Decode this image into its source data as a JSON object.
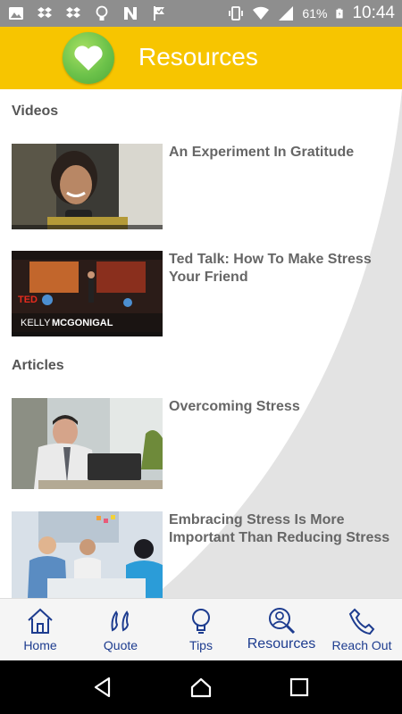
{
  "status_bar": {
    "battery_percent": "61%",
    "time": "10:44",
    "left_icons": [
      "image-icon",
      "dropbox-icon",
      "dropbox-icon",
      "lightbulb-icon",
      "n-icon",
      "check-flag-icon"
    ],
    "right_icons": [
      "vibrate-icon",
      "wifi-icon",
      "signal-icon",
      "battery-icon"
    ]
  },
  "header": {
    "title": "Resources",
    "logo_icon": "heart-icon",
    "background": "#f7c500"
  },
  "sections": {
    "videos": {
      "title": "Videos",
      "items": [
        {
          "title": "An Experiment In Gratitude",
          "thumb": "woman-on-phone"
        },
        {
          "title": "Ted Talk: How To Make Stress Your Friend",
          "thumb": "ted-talk-stage",
          "thumb_caption_a": "TED",
          "thumb_caption_b": "KELLY",
          "thumb_caption_c": "MCGONIGAL"
        }
      ]
    },
    "articles": {
      "title": "Articles",
      "items": [
        {
          "title": "Overcoming Stress",
          "thumb": "stressed-man-at-laptop"
        },
        {
          "title": "Embracing Stress Is More Important Than Reducing Stress",
          "thumb": "team-meeting"
        }
      ]
    }
  },
  "bottom_nav": {
    "items": [
      {
        "label": "Home",
        "icon": "home-icon"
      },
      {
        "label": "Quote",
        "icon": "quote-icon"
      },
      {
        "label": "Tips",
        "icon": "lightbulb-icon"
      },
      {
        "label": "Resources",
        "icon": "search-person-icon",
        "active": true
      },
      {
        "label": "Reach Out",
        "icon": "phone-icon"
      }
    ],
    "color": "#1d3c8f"
  },
  "system_nav": {
    "buttons": [
      "back-icon",
      "home-icon",
      "recents-icon"
    ]
  }
}
